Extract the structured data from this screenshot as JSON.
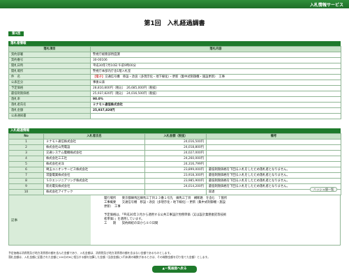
{
  "header": {
    "service_title": "入札情報サービス"
  },
  "page": {
    "title": "第1回　入札経過調書",
    "round_tab": "第1回"
  },
  "colors": {
    "accent": "#1e7a2b",
    "label_bg": "#d9ecd9",
    "warning_text": "#c00000"
  },
  "award": {
    "section_title": "落札者情報",
    "col_item": "落札項目",
    "col_content": "落札内容",
    "rows": [
      {
        "label": "契約部署",
        "value": "警視庁総務部用度課"
      },
      {
        "label": "契約番号",
        "value": "30-00106"
      },
      {
        "label": "開札日時",
        "value": "平成30年7月10日 午前9時00分"
      },
      {
        "label": "開札場所",
        "value": "警視庁本部内庁舎1階入札室"
      },
      {
        "label": "件　名",
        "badge": "【電子】",
        "value": "交通信号機　移設・改良（多現示化・地下線化）・更新（集中式制御機・施設更新）　工事"
      },
      {
        "label": "公表区分",
        "value": "事後公表"
      },
      {
        "label": "予定価格",
        "value": "28,810,800円（税込）　26,685,000円（税抜）"
      },
      {
        "label": "最低制限価格",
        "value": "25,937,820円（税込）　24,016,500円（税抜）"
      },
      {
        "label": "落札率",
        "value": "90.0%"
      },
      {
        "label": "落札者氏名",
        "value": "ミナモト通信株式会社"
      },
      {
        "label": "落札金額",
        "value": "25,937,820円"
      },
      {
        "label": "公表通知書",
        "value": ""
      }
    ]
  },
  "bids": {
    "section_title": "入札経過情報",
    "col_no": "No",
    "col_name": "入札者氏名",
    "col_amount": "入札金額（税抜）",
    "col_note": "備考",
    "rows": [
      {
        "no": "1",
        "name": "ミナモト通信株式会社",
        "amount": "24,016,500円",
        "note": ""
      },
      {
        "no": "2",
        "name": "株式会社山晃電設",
        "amount": "24,018,800円",
        "note": ""
      },
      {
        "no": "3",
        "name": "交通システム電機株式会社",
        "amount": "24,027,000円",
        "note": ""
      },
      {
        "no": "4",
        "name": "株式会社三工社",
        "amount": "24,260,000円",
        "note": ""
      },
      {
        "no": "5",
        "name": "株式会社光洋",
        "amount": "24,316,799円",
        "note": ""
      },
      {
        "no": "6",
        "name": "埼玉ユニオンサービス株式会社",
        "amount": "23,899,000円",
        "note": "最低制限価格を下回る入札をしたため落札者となりません。"
      },
      {
        "no": "7",
        "name": "常盤電業株式会社",
        "amount": "23,918,300円",
        "note": "最低制限価格を下回る入札をしたため落札者となりません。"
      },
      {
        "no": "8",
        "name": "ＳＤエンジニアリング株式会社",
        "amount": "23,985,900円",
        "note": "最低制限価格を下回る入札をしたため落札者となりません。"
      },
      {
        "no": "9",
        "name": "新光電気株式会社",
        "amount": "24,014,200円",
        "note": "最低制限価格を下回る入札をしたため落札者となりません。"
      },
      {
        "no": "10",
        "name": "株式会社アイテック",
        "amount": "",
        "note": "辞退"
      }
    ]
  },
  "hash_button": "ハッシュ値一覧",
  "remarks": {
    "label": "記事",
    "text": "履行場所　　東京都練馬区練馬三丁目２３番１号先　練馬三丁目　構断路　を含む　７箇所\n工事概要　　交通信号機　移設・改良（多現示化・地下線化）・更新（集中式制御機・施設\n更新）　工事\n\n予定価格は、「平成30年３月から適用する公共工事設計労務単価（又は設計業務委託等技術\n者単価）」を適用しています。\n工　　期　　契約締結の日から８０日間"
  },
  "footnote": {
    "line1": "予定価格は消費税及び地方消費税の額を含んだ金額であり、入札金額は、消費税及び地方消費税の額を含まない金額であるものとします。",
    "line2": "落札金額は、入札金額に記載された金額に100分の8に相当する額を加算した金額（当該金額に1円未満の端数があるときは、その端数金額を切り捨てた金額）とします。"
  },
  "back_button": "▲一覧画面へ戻る"
}
